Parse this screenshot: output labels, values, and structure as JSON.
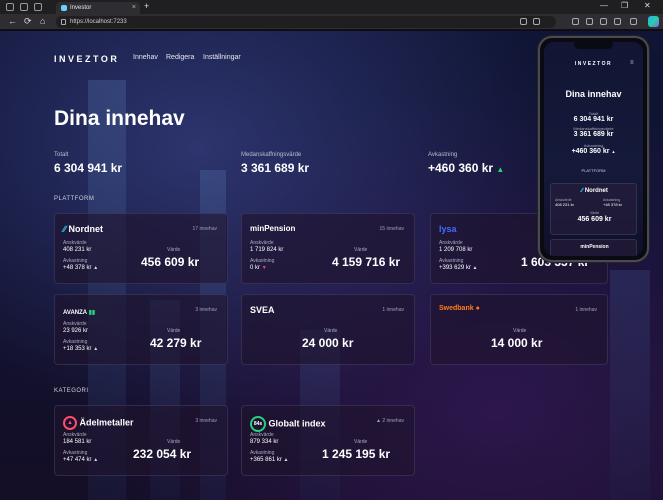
{
  "browser": {
    "tab_title": "Investor",
    "url": "https://localhost:7233",
    "new_tab": "+",
    "close": "×",
    "back": "←",
    "reload": "⟳",
    "home": "⌂",
    "win_min": "—",
    "win_max": "❐",
    "win_close": "✕"
  },
  "nav": {
    "logo": "INVEZTOR",
    "links": [
      "Innehav",
      "Redigera",
      "Inställningar"
    ]
  },
  "header": {
    "title": "Dina innehav"
  },
  "stats": [
    {
      "label": "Totalt",
      "value": "6 304 941 kr"
    },
    {
      "label": "Medanskaffningsvärde",
      "value": "3 361 689 kr"
    },
    {
      "label": "Avkastning",
      "value": "+460 360 kr"
    }
  ],
  "sections": {
    "platform": "PLATTFORM",
    "category": "KATEGORI"
  },
  "platforms": [
    {
      "brand": "Nordnet",
      "count": "17 innehav",
      "ansk_label": "Anskvärde",
      "ansk": "408 231 kr",
      "avk_label": "Avkastning",
      "avk": "+48 378 kr",
      "dir": "up",
      "value_label": "Värde",
      "value": "456 609 kr",
      "brand_color": "#ffffff"
    },
    {
      "brand": "minPension",
      "count": "15 innehav",
      "ansk_label": "Anskvärde",
      "ansk": "1 719 824 kr",
      "avk_label": "Avkastning",
      "avk": "0 kr",
      "dir": "down",
      "value_label": "Värde",
      "value": "4 159 716 kr",
      "brand_color": "#ffffff"
    },
    {
      "brand": "lysa",
      "count": "",
      "ansk_label": "Anskvärde",
      "ansk": "1 209 708 kr",
      "avk_label": "Avkastning",
      "avk": "+393 629 kr",
      "dir": "up",
      "value_label": "",
      "value": "1 603 337 kr",
      "brand_color": "#3f6bff"
    },
    {
      "brand": "AVANZA",
      "count": "3 innehav",
      "ansk_label": "Anskvärde",
      "ansk": "23 926 kr",
      "avk_label": "Avkastning",
      "avk": "+18 353 kr",
      "dir": "up",
      "value_label": "Värde",
      "value": "42 279 kr",
      "brand_color": "#ffffff"
    },
    {
      "brand": "SVEA",
      "count": "1 innehav",
      "ansk_label": "",
      "ansk": "",
      "avk_label": "",
      "avk": "",
      "dir": "",
      "value_label": "Värde",
      "value": "24 000 kr",
      "brand_color": "#ffffff"
    },
    {
      "brand": "Swedbank",
      "count": "1 innehav",
      "ansk_label": "",
      "ansk": "",
      "avk_label": "",
      "avk": "",
      "dir": "",
      "value_label": "Värde",
      "value": "14 000 kr",
      "brand_color": "#ff7a1a"
    }
  ],
  "categories": [
    {
      "name": "Ädelmetaller",
      "count": "3 innehav",
      "ansk_label": "Anskvärde",
      "ansk": "184 581 kr",
      "avk_label": "Avkastning",
      "avk": "+47 474 kr",
      "value_label": "Värde",
      "value": "232 054 kr",
      "badge": "",
      "warn": false
    },
    {
      "name": "Globalt index",
      "count": "2 innehav",
      "ansk_label": "Anskvärde",
      "ansk": "879 334 kr",
      "avk_label": "Avkastning",
      "avk": "+365 861 kr",
      "value_label": "Värde",
      "value": "1 245 195 kr",
      "badge": "84s",
      "warn": true
    }
  ],
  "phone": {
    "logo": "INVEZTOR",
    "title": "Dina innehav",
    "total_label": "Totalt",
    "total": "6 304 941 kr",
    "msk_label": "Medanskaffningsvärde",
    "msk": "3 361 689 kr",
    "avk_label": "Avkastning",
    "avk": "+460 360 kr",
    "platform_label": "PLATTFORM",
    "card_brand": "Nordnet",
    "card_ansk_label": "Anskvärde",
    "card_ansk": "408 231 kr",
    "card_avk_label": "Avkastning",
    "card_avk": "+48 378 kr",
    "card_value_label": "Värde",
    "card_value": "456 609 kr",
    "next_brand": "minPension"
  },
  "colors": {
    "accent_up": "#27d07d",
    "accent_down": "#ff4d6a",
    "warn": "#ff6a6a"
  }
}
